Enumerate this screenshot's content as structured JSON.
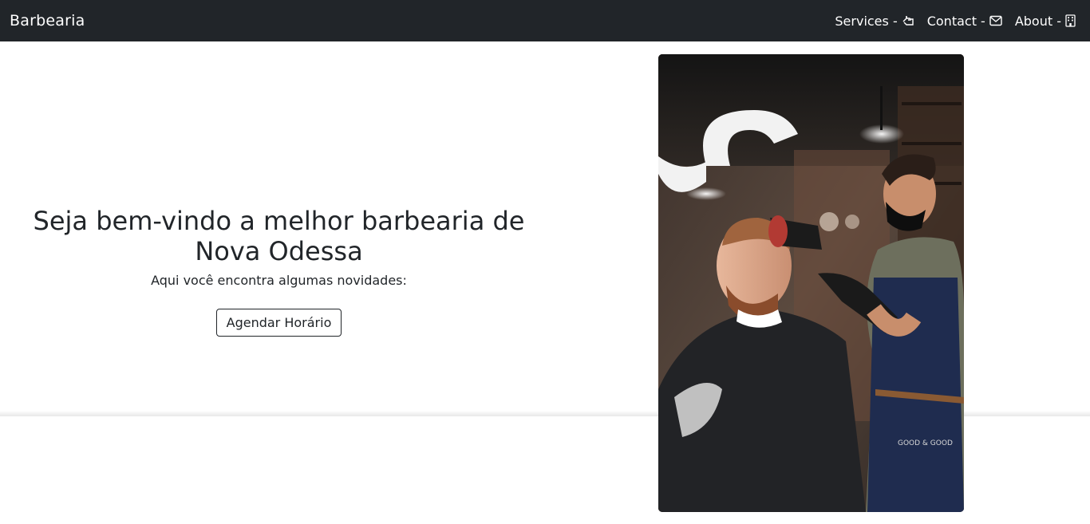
{
  "navbar": {
    "brand": "Barbearia",
    "links": [
      {
        "label": "Services -",
        "icon": "bell-service-icon"
      },
      {
        "label": "Contact -",
        "icon": "envelope-icon"
      },
      {
        "label": "About -",
        "icon": "building-icon"
      }
    ]
  },
  "hero": {
    "title": "Seja bem-vindo a melhor barbearia de Nova Odessa",
    "subtitle": "Aqui você encontra algumas novidades:",
    "button_label": "Agendar Horário"
  },
  "photo": {
    "subject": "barber-haircut-photo",
    "apron_text": "GOOD & GOOD"
  },
  "colors": {
    "navbar_bg": "#212529",
    "navbar_text": "#ffffff",
    "body_text": "#212529",
    "button_border": "#212529"
  }
}
